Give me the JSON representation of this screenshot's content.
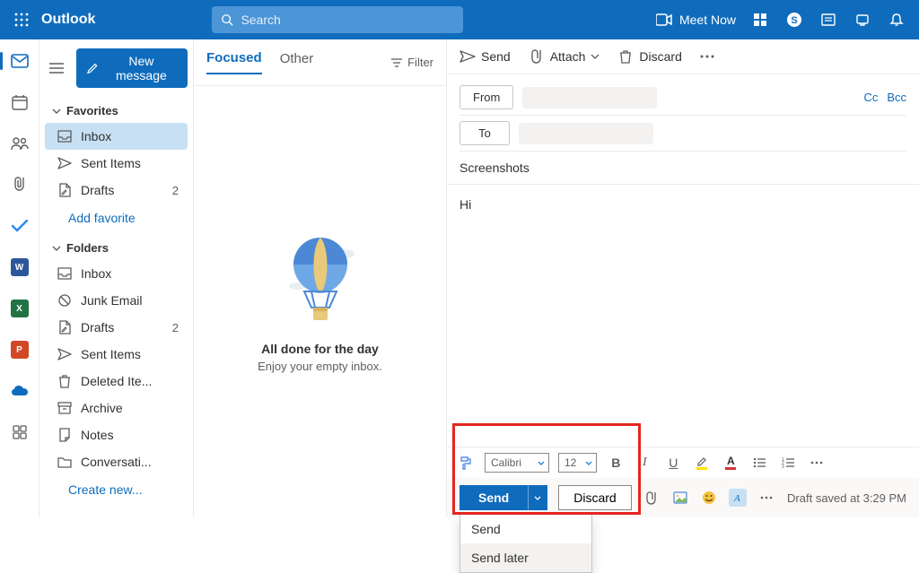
{
  "header": {
    "app_title": "Outlook",
    "search_placeholder": "Search",
    "meet_now": "Meet Now"
  },
  "nav": {
    "new_message": "New message",
    "favorites_label": "Favorites",
    "favorites": [
      {
        "icon": "inbox",
        "label": "Inbox",
        "count": "",
        "selected": true
      },
      {
        "icon": "sent",
        "label": "Sent Items",
        "count": ""
      },
      {
        "icon": "drafts",
        "label": "Drafts",
        "count": "2"
      }
    ],
    "add_favorite": "Add favorite",
    "folders_label": "Folders",
    "folders": [
      {
        "icon": "inbox",
        "label": "Inbox",
        "count": ""
      },
      {
        "icon": "junk",
        "label": "Junk Email",
        "count": ""
      },
      {
        "icon": "drafts",
        "label": "Drafts",
        "count": "2"
      },
      {
        "icon": "sent",
        "label": "Sent Items",
        "count": ""
      },
      {
        "icon": "trash",
        "label": "Deleted Ite...",
        "count": ""
      },
      {
        "icon": "archive",
        "label": "Archive",
        "count": ""
      },
      {
        "icon": "notes",
        "label": "Notes",
        "count": ""
      },
      {
        "icon": "folder",
        "label": "Conversati...",
        "count": ""
      }
    ],
    "create_new": "Create new..."
  },
  "list": {
    "tab_focused": "Focused",
    "tab_other": "Other",
    "filter": "Filter",
    "empty_title": "All done for the day",
    "empty_sub": "Enjoy your empty inbox."
  },
  "compose": {
    "cmd_send": "Send",
    "cmd_attach": "Attach",
    "cmd_discard": "Discard",
    "from_label": "From",
    "to_label": "To",
    "cc": "Cc",
    "bcc": "Bcc",
    "subject": "Screenshots",
    "body": "Hi",
    "font_name": "Calibri",
    "font_size": "12",
    "send_btn": "Send",
    "discard_btn": "Discard",
    "status": "Draft saved at 3:29 PM",
    "menu_send": "Send",
    "menu_send_later": "Send later"
  }
}
